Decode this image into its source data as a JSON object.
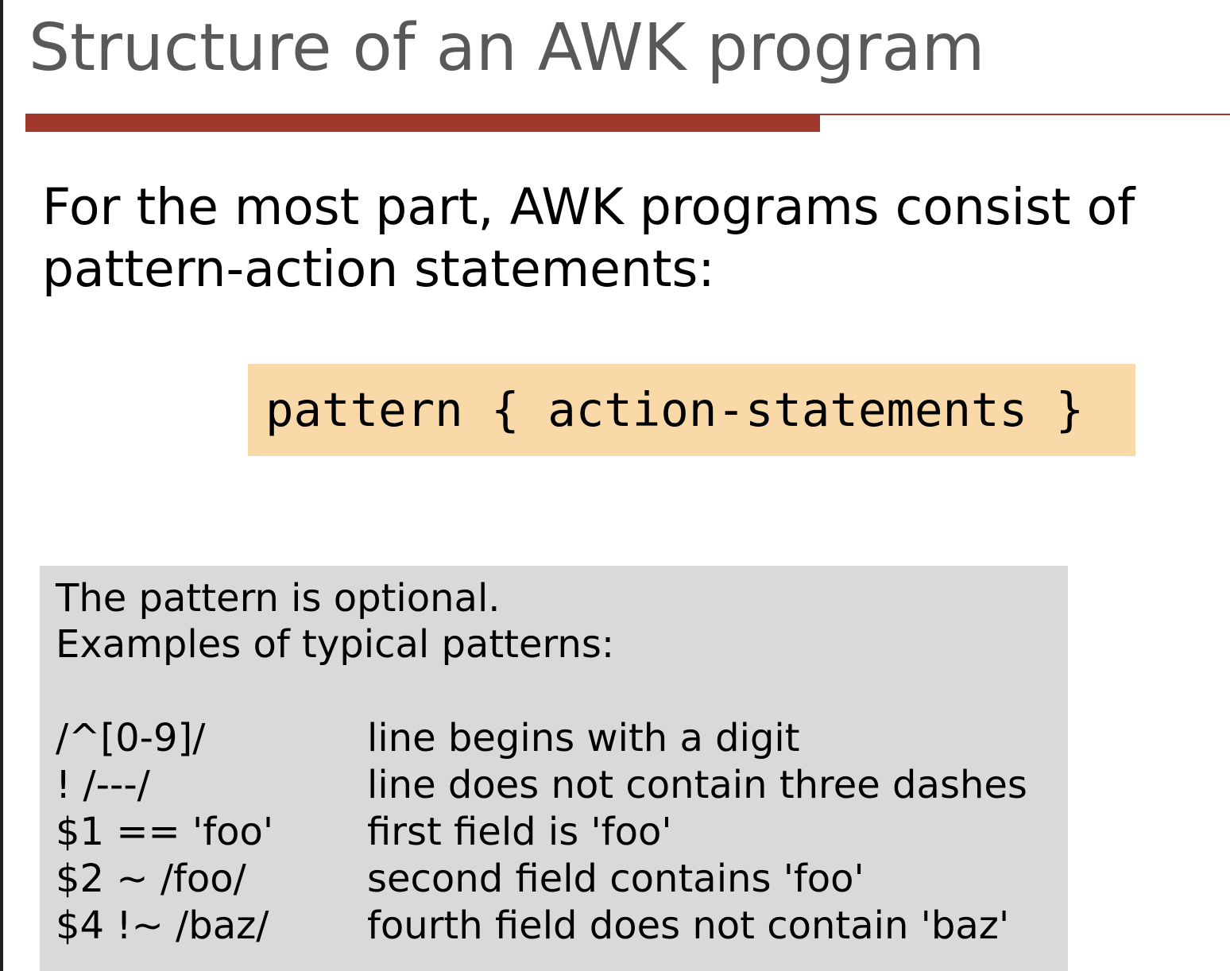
{
  "slide": {
    "title": "Structure of an AWK program",
    "intro": "For the most part, AWK programs consist of pattern-action statements:",
    "code": "pattern { action-statements }",
    "note": {
      "line1": "The pattern is optional.",
      "line2": "Examples of typical patterns:",
      "examples": [
        {
          "pattern": "/^[0-9]/",
          "description": "line begins with a digit"
        },
        {
          "pattern": "! /---/",
          "description": "line does not contain three dashes"
        },
        {
          "pattern": "$1 == 'foo'",
          "description": "first field is 'foo'"
        },
        {
          "pattern": "$2 ~ /foo/",
          "description": "second field contains 'foo'"
        },
        {
          "pattern": "$4 !~ /baz/",
          "description": "fourth field does not contain 'baz'"
        }
      ]
    }
  },
  "colors": {
    "title_text": "#595959",
    "accent_rule": "#a0382c",
    "code_box_bg": "#f9d9a8",
    "note_box_bg": "#d9d9d9"
  }
}
